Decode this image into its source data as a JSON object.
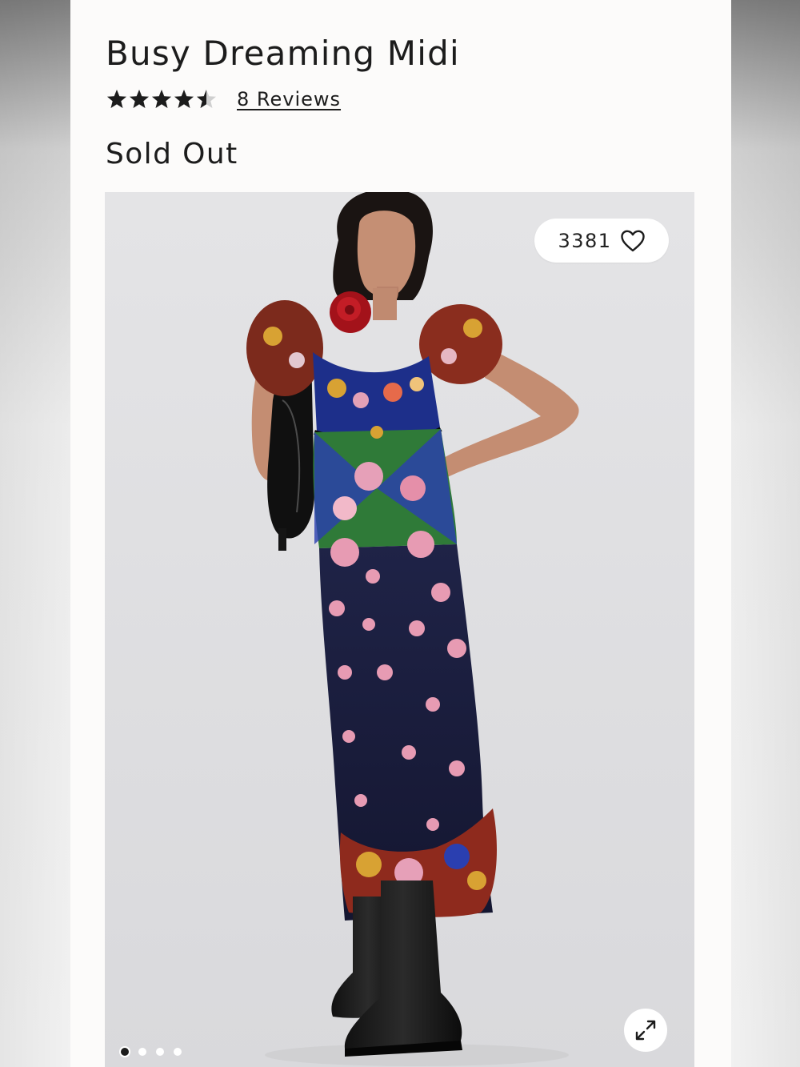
{
  "product": {
    "title": "Busy Dreaming Midi",
    "rating": 4.5,
    "rating_max": 5,
    "reviews_label": "8 Reviews",
    "status": "Sold Out"
  },
  "gallery": {
    "favorite_count": "3381",
    "image_count": 4,
    "active_index": 0
  },
  "colors": {
    "text": "#1c1c1c",
    "card_background": "#fcfbfa",
    "photo_background": "#e6e6e8"
  },
  "icons": {
    "rating": "star-icon",
    "favorite": "heart-outline-icon",
    "expand": "expand-arrows-icon"
  }
}
